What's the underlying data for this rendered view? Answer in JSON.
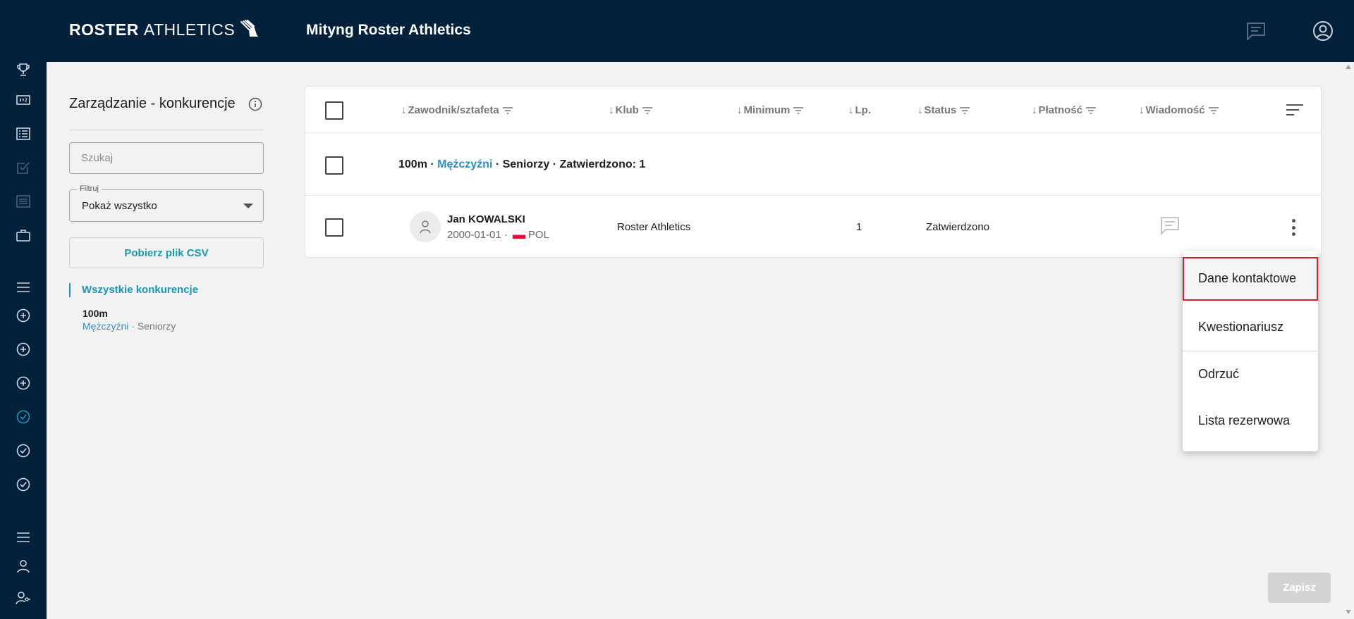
{
  "header": {
    "logo_bold": "ROSTER",
    "logo_regular": "ATHLETICS",
    "title": "Mityng Roster Athletics"
  },
  "sidebar": {
    "icons": [
      "trophy-icon",
      "scoreboard-icon",
      "list-icon",
      "checklist-icon",
      "document-icon",
      "briefcase-icon",
      "menu-icon",
      "add-circle-icon",
      "add-circle-icon",
      "add-circle-icon",
      "check-circle-icon",
      "check-circle-icon",
      "check-circle-icon",
      "menu-icon",
      "person-icon",
      "person-key-icon"
    ]
  },
  "panel": {
    "title": "Zarządzanie - konkurencje",
    "search_placeholder": "Szukaj",
    "filter_label": "Filtruj",
    "filter_value": "Pokaż wszystko",
    "csv_button": "Pobierz plik CSV",
    "all_events": "Wszystkie konkurencje",
    "event": {
      "name": "100m",
      "gender": "Mężczyźni",
      "separator": " · ",
      "category": "Seniorzy"
    }
  },
  "table": {
    "columns": {
      "athlete": "Zawodnik/sztafeta",
      "club": "Klub",
      "minimum": "Minimum",
      "lp": "Lp.",
      "status": "Status",
      "payment": "Płatność",
      "message": "Wiadomość"
    },
    "group": {
      "event": "100m · ",
      "gender": "Mężczyźni",
      "rest": " · Seniorzy · Zatwierdzono: 1"
    },
    "row": {
      "name": "Jan KOWALSKI",
      "birth": "2000-01-01 ·",
      "country": "POL",
      "club": "Roster Athletics",
      "lp": "1",
      "status": "Zatwierdzono"
    }
  },
  "menu": {
    "contact": "Dane kontaktowe",
    "questionnaire": "Kwestionariusz",
    "reject": "Odrzuć",
    "reserve": "Lista rezerwowa"
  },
  "save_button": "Zapisz",
  "colors": {
    "navy": "#04213c",
    "accent": "#1a97b3",
    "link_blue": "#2e8fc4",
    "highlight_red": "#d5202e",
    "flag_red": "#dc143c"
  }
}
